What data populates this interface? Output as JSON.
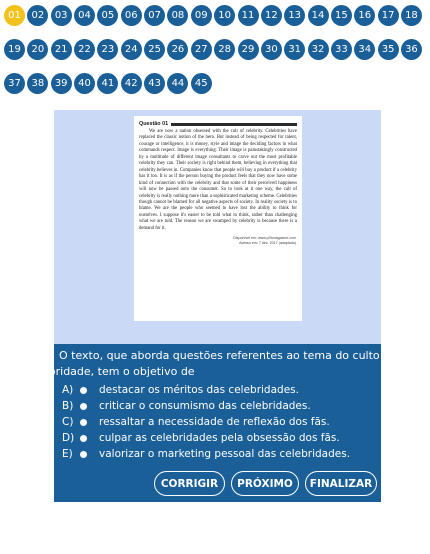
{
  "navigator": {
    "current": "01",
    "items": [
      "01",
      "02",
      "03",
      "04",
      "05",
      "06",
      "07",
      "08",
      "09",
      "10",
      "11",
      "12",
      "13",
      "14",
      "15",
      "16",
      "17",
      "18",
      "19",
      "20",
      "21",
      "22",
      "23",
      "24",
      "25",
      "26",
      "27",
      "28",
      "29",
      "30",
      "31",
      "32",
      "33",
      "34",
      "35",
      "36",
      "37",
      "38",
      "39",
      "40",
      "41",
      "42",
      "43",
      "44",
      "45"
    ]
  },
  "colors": {
    "primary": "#1b5f98",
    "active": "#f2c21a",
    "panel": "#c9d9f6"
  },
  "document": {
    "title": "Questão 01",
    "paragraph": "We are now a nation obsessed with the cult of celebrity. Celebrities have replaced the classic notion of the hero. But instead of being respected for talent, courage or intelligence, it is money, style and image the deciding factors in what commands respect. Image is everything. Their image is painstakingly constructed by a multitude of different image consultants to carve out the most profitable celebrity they can. Their society is right behind them, believing in everything that celebrity believes in. Companies know that people will buy a product if a celebrity has it too. It is as if the person buying the product feels that they now have some kind of connection with the celebrity and that some of their perceived happiness will now be passed onto the consumer. So to look at it one way, the cult of celebrity is really nothing more than a sophisticated marketing scheme. Celebrities though cannot be blamed for all negative aspects of society. In reality society is to blame. We are the people who seemed to have lost the ability to think for ourselves. I suppose it's easier to be told what to think, rather than challenging what we are told. The reason we are swamped by celebrity is because there is a demand for it.",
    "source_line1": "Disponível em: www.p2bmagazine.com.",
    "source_line2": "Acesso em: 7 dez. 2017 (adaptado)."
  },
  "question": {
    "stem_line1": "O texto, que aborda questões referentes ao tema do culto à",
    "stem_line2": "celebridade, tem o objetivo de",
    "alternatives": [
      {
        "letter": "A)",
        "text": "destacar os méritos das celebridades."
      },
      {
        "letter": "B)",
        "text": "criticar o consumismo das celebridades."
      },
      {
        "letter": "C)",
        "text": "ressaltar a necessidade de reflexão dos fãs."
      },
      {
        "letter": "D)",
        "text": "culpar as celebridades pela obsessão dos fãs."
      },
      {
        "letter": "E)",
        "text": "valorizar o marketing pessoal das celebridades."
      }
    ]
  },
  "buttons": {
    "check": "CORRIGIR",
    "next": "PRÓXIMO",
    "finish": "FINALIZAR"
  }
}
